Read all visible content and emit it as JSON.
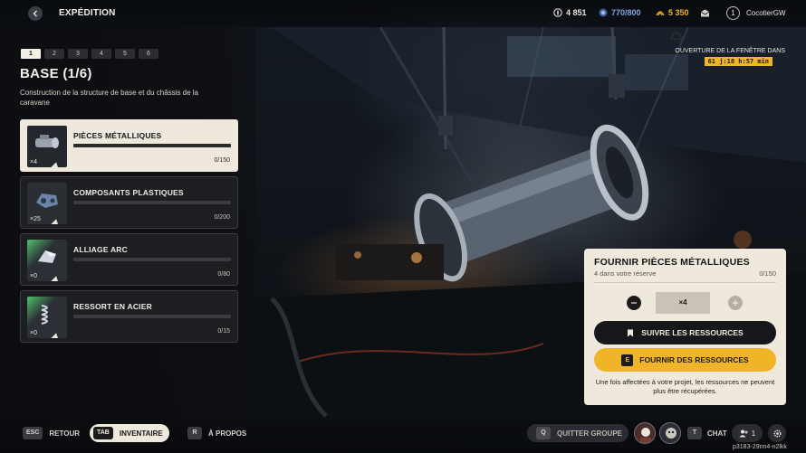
{
  "header": {
    "title": "EXPÉDITION",
    "coins": "4 851",
    "energy": "770/800",
    "tokens": "5 350",
    "level": "1",
    "username": "CocotierGW"
  },
  "stage": {
    "steps": [
      "1",
      "2",
      "3",
      "4",
      "5",
      "6"
    ],
    "active_step": 1,
    "title": "BASE (1/6)",
    "description": "Construction de la structure de base et du châssis de la caravane"
  },
  "resources": [
    {
      "name": "PIÈCES MÉTALLIQUES",
      "qty": "×4",
      "count": "0/150",
      "progress": 0
    },
    {
      "name": "COMPOSANTS PLASTIQUES",
      "qty": "×25",
      "count": "0/200",
      "progress": 0
    },
    {
      "name": "ALLIAGE ARC",
      "qty": "×0",
      "count": "0/80",
      "progress": 0
    },
    {
      "name": "RESSORT EN ACIER",
      "qty": "×0",
      "count": "0/15",
      "progress": 0
    }
  ],
  "window": {
    "label": "OUVERTURE DE LA FENÊTRE DANS",
    "timer": "61 j:18 h:57 min"
  },
  "supply": {
    "title": "FOURNIR PIÈCES MÉTALLIQUES",
    "subtitle": "4 dans votre réserve",
    "count": "0/150",
    "quantity": "×4",
    "track_label": "SUIVRE LES RESSOURCES",
    "supply_key": "E",
    "supply_label": "FOURNIR DES RESSOURCES",
    "note": "Une fois affectées à votre projet, les ressources ne peuvent plus être récupérées."
  },
  "footer": {
    "back_key": "ESC",
    "back_label": "RETOUR",
    "inventory_key": "TAB",
    "inventory_label": "INVENTAIRE",
    "about_key": "R",
    "about_label": "À PROPOS",
    "quit_key": "Q",
    "quit_label": "QUITTER GROUPE",
    "chat_key": "T",
    "chat_label": "CHAT",
    "friends_count": "1",
    "session_id": "p3183-29nn4-n2lkk"
  },
  "colors": {
    "accent": "#f0b429",
    "panel_light": "#efe9dd",
    "energy": "#7fa6e8",
    "green_rarity": "#4fc36a"
  }
}
